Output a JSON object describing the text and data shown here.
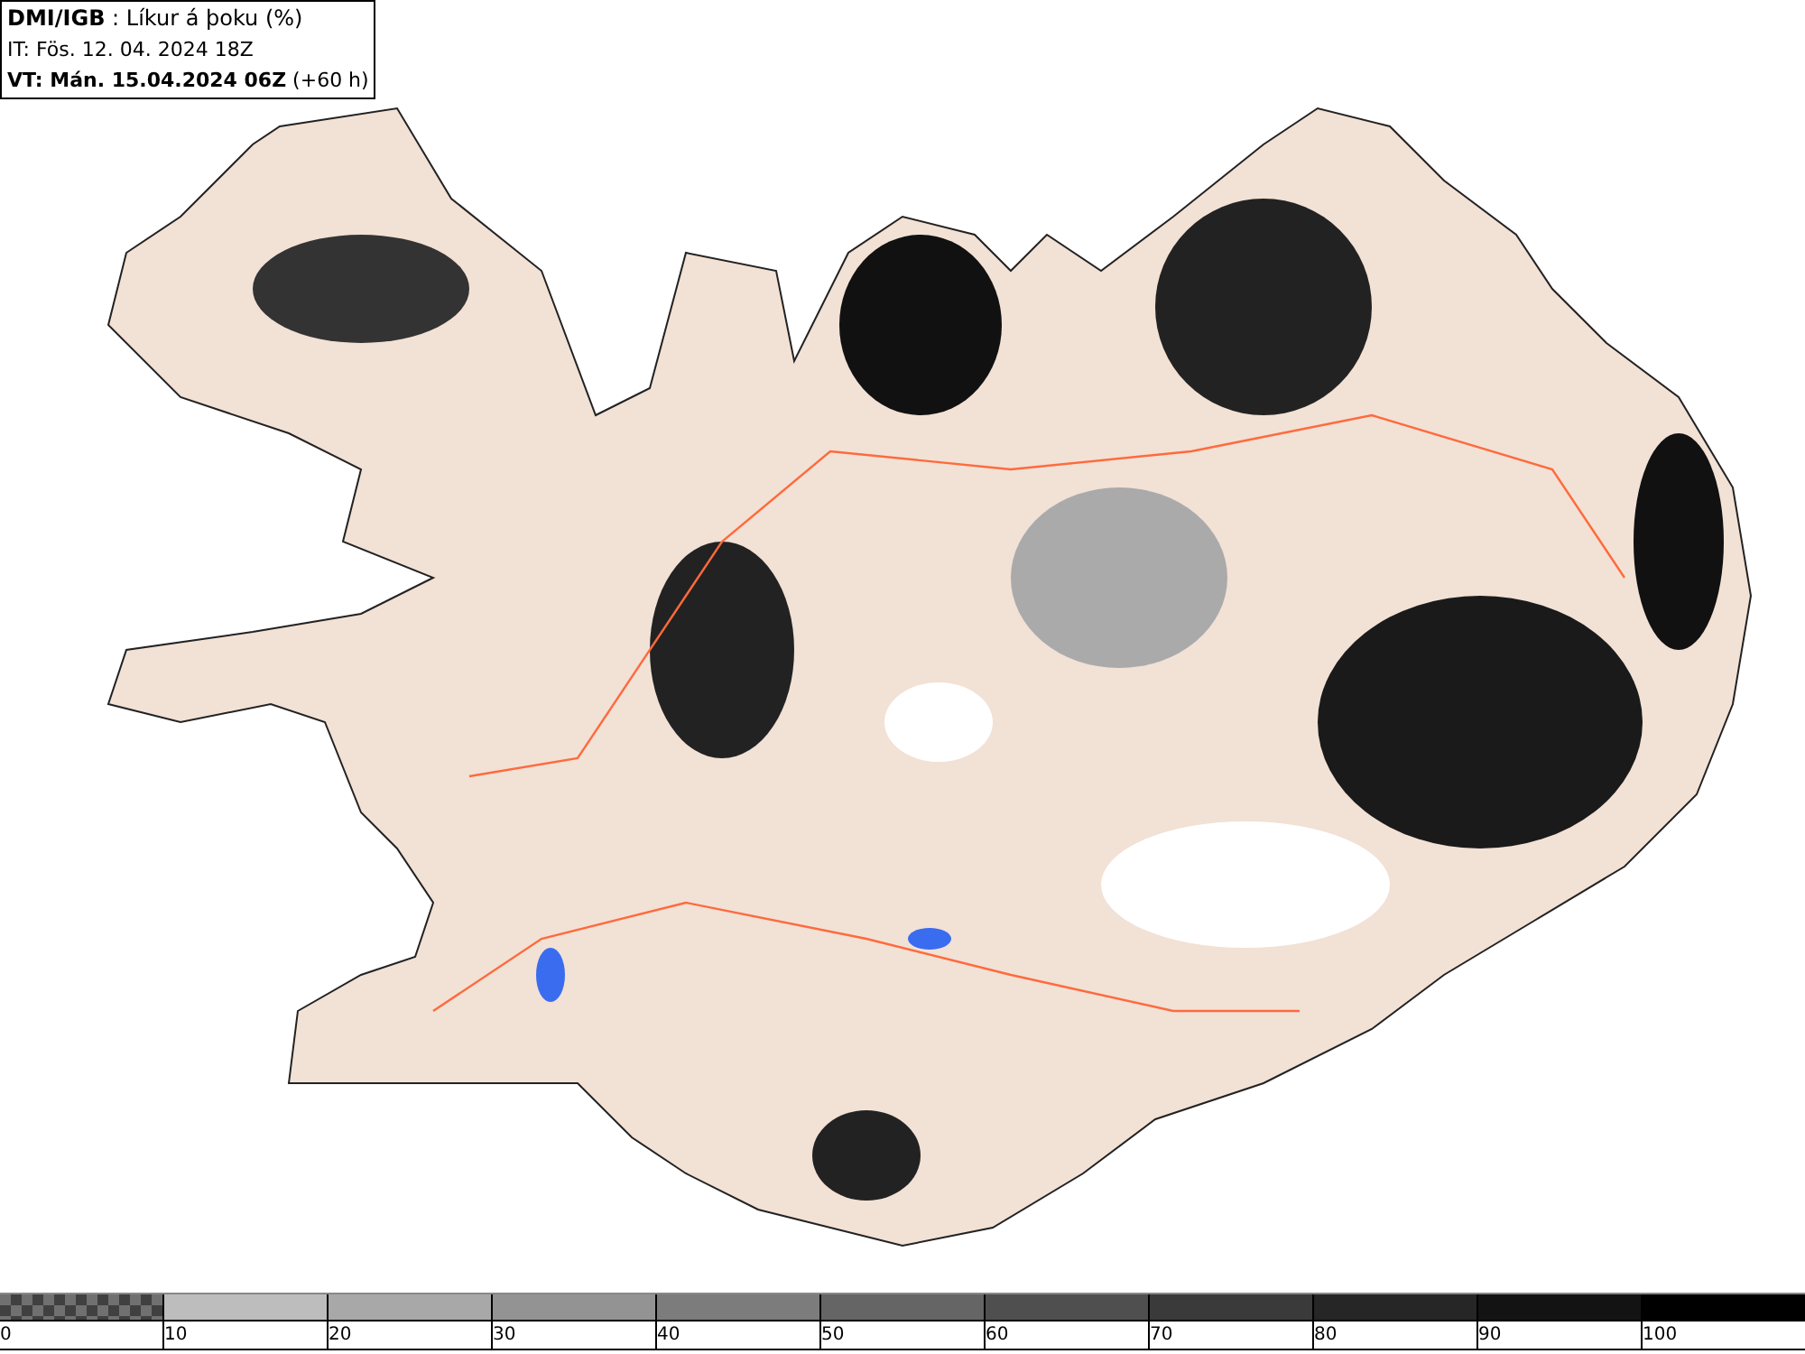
{
  "title_box": {
    "source": "DMI/IGB",
    "field": " : Líkur á þoku (%)",
    "issue_time": "IT: Fös. 12. 04. 2024 18Z",
    "valid_time": "VT: Mán. 15.04.2024 06Z",
    "lead": " (+60 h)"
  },
  "legend": [
    {
      "label": "0",
      "kind": "checker",
      "color": "#707070"
    },
    {
      "label": "10",
      "kind": "solid",
      "color": "#bdbdbd"
    },
    {
      "label": "20",
      "kind": "solid",
      "color": "#a8a8a8"
    },
    {
      "label": "30",
      "kind": "solid",
      "color": "#939393"
    },
    {
      "label": "40",
      "kind": "solid",
      "color": "#7c7c7c"
    },
    {
      "label": "50",
      "kind": "solid",
      "color": "#656565"
    },
    {
      "label": "60",
      "kind": "solid",
      "color": "#4f4f4f"
    },
    {
      "label": "70",
      "kind": "solid",
      "color": "#3a3a3a"
    },
    {
      "label": "80",
      "kind": "solid",
      "color": "#262626"
    },
    {
      "label": "90",
      "kind": "solid",
      "color": "#131313"
    },
    {
      "label": "100",
      "kind": "solid",
      "color": "#000000"
    }
  ]
}
